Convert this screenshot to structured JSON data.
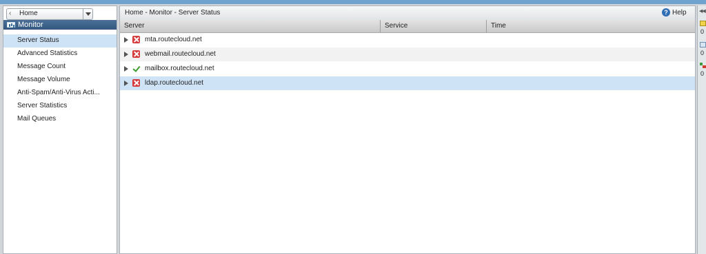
{
  "nav": {
    "home_label": "Home",
    "section_title": "Monitor",
    "items": [
      {
        "label": "Server Status",
        "selected": true
      },
      {
        "label": "Advanced Statistics",
        "selected": false
      },
      {
        "label": "Message Count",
        "selected": false
      },
      {
        "label": "Message Volume",
        "selected": false
      },
      {
        "label": "Anti-Spam/Anti-Virus Acti...",
        "selected": false
      },
      {
        "label": "Server Statistics",
        "selected": false
      },
      {
        "label": "Mail Queues",
        "selected": false
      }
    ]
  },
  "main": {
    "breadcrumb": "Home - Monitor - Server Status",
    "help_label": "Help",
    "columns": [
      "Server",
      "Service",
      "Time"
    ],
    "rows": [
      {
        "server": "mta.routecloud.net",
        "status": "error"
      },
      {
        "server": "webmail.routecloud.net",
        "status": "error"
      },
      {
        "server": "mailbox.routecloud.net",
        "status": "ok"
      },
      {
        "server": "ldap.routecloud.net",
        "status": "error",
        "selected": true
      }
    ]
  },
  "right_panel": {
    "counts": [
      "0",
      "0",
      "0"
    ]
  },
  "colors": {
    "accent_header": "#33587f",
    "selection": "#cfe3f7",
    "error": "#d63b3b",
    "ok": "#3c9c2c"
  }
}
